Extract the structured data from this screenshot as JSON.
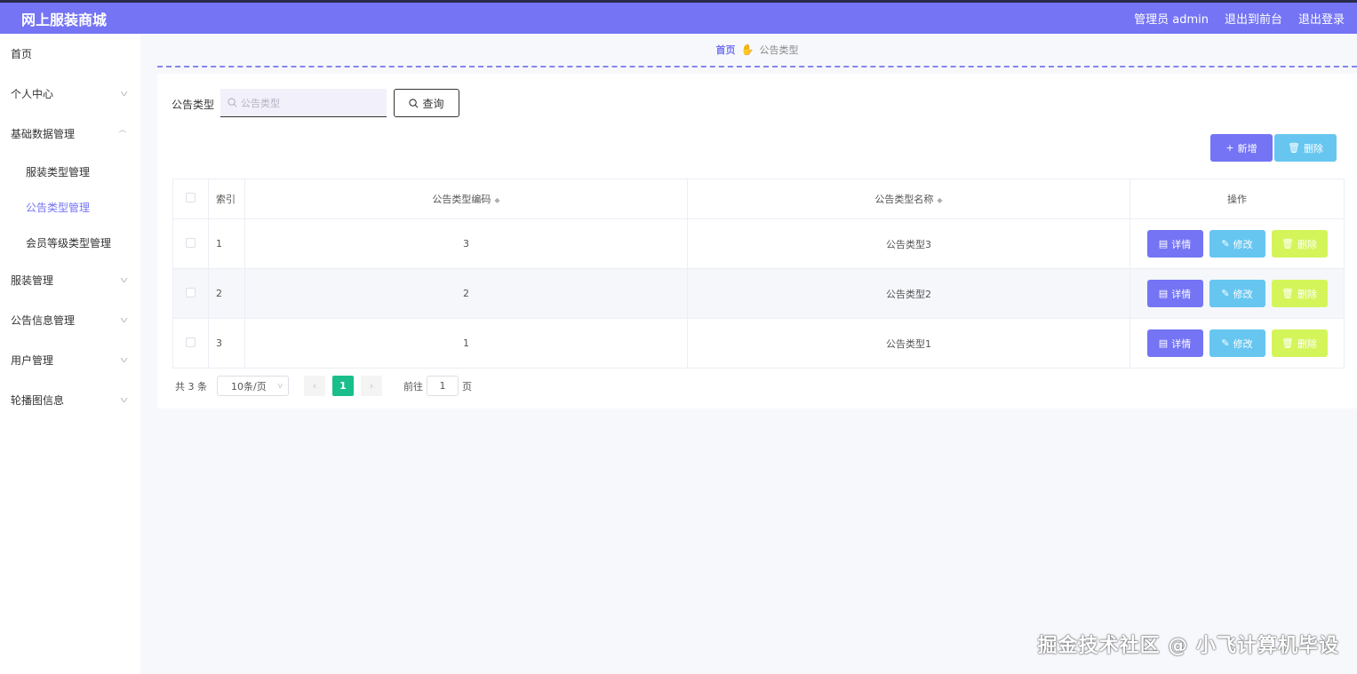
{
  "header": {
    "logo": "网上服装商城",
    "user": "管理员 admin",
    "to_front": "退出到前台",
    "logout": "退出登录"
  },
  "sidebar": {
    "home": "首页",
    "personal": "个人中心",
    "basic": "基础数据管理",
    "sub": [
      "服装类型管理",
      "公告类型管理",
      "会员等级类型管理"
    ],
    "clothes": "服装管理",
    "notice": "公告信息管理",
    "users": "用户管理",
    "carousel": "轮播图信息"
  },
  "breadcrumb": {
    "home": "首页",
    "current": "公告类型"
  },
  "search": {
    "label": "公告类型",
    "placeholder": "公告类型",
    "button": "查询"
  },
  "toolbar": {
    "add": "新增",
    "delete": "删除"
  },
  "table": {
    "headers": {
      "index": "索引",
      "code": "公告类型编码",
      "name": "公告类型名称",
      "ops": "操作"
    },
    "rows": [
      {
        "index": "1",
        "code": "3",
        "name": "公告类型3"
      },
      {
        "index": "2",
        "code": "2",
        "name": "公告类型2"
      },
      {
        "index": "3",
        "code": "1",
        "name": "公告类型1"
      }
    ],
    "op_labels": {
      "detail": "详情",
      "edit": "修改",
      "delete": "删除"
    }
  },
  "pagination": {
    "total": "共 3 条",
    "page_size": "10条/页",
    "current_page": "1",
    "goto_label": "前往",
    "goto_value": "1",
    "page_unit": "页"
  },
  "watermark": "掘金技术社区 @ 小飞计算机毕设",
  "colors": {
    "primary": "#7474f4",
    "info": "#66c6f0",
    "danger": "#d4f55a",
    "page_active": "#19be8b"
  }
}
